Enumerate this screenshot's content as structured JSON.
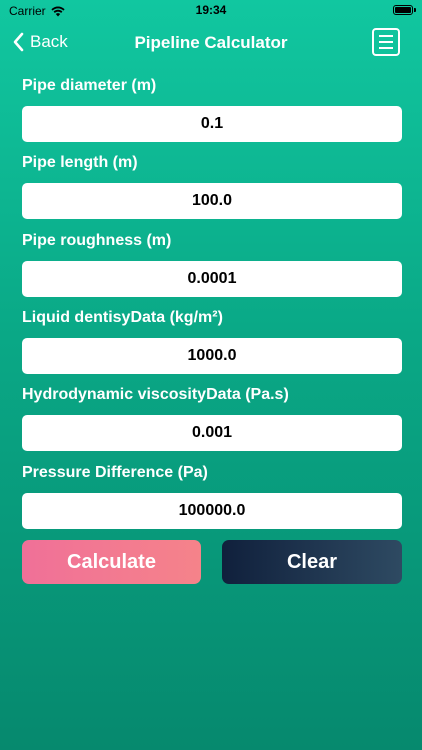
{
  "status_bar": {
    "carrier": "Carrier",
    "time": "19:34"
  },
  "nav": {
    "back_label": "Back",
    "title": "Pipeline Calculator"
  },
  "fields": [
    {
      "label": "Pipe diameter (m)",
      "value": "0.1"
    },
    {
      "label": "Pipe length (m)",
      "value": "100.0"
    },
    {
      "label": "Pipe roughness (m)",
      "value": "0.0001"
    },
    {
      "label": "Liquid dentisyData (kg/m²)",
      "value": "1000.0"
    },
    {
      "label": "Hydrodynamic viscosityData (Pa.s)",
      "value": "0.001"
    },
    {
      "label": "Pressure Difference (Pa)",
      "value": "100000.0"
    }
  ],
  "buttons": {
    "calculate": "Calculate",
    "clear": "Clear"
  },
  "colors": {
    "background_top": "#11c7a0",
    "background_bottom": "#06896e",
    "calculate_button": "#f07098",
    "clear_button": "#10203c"
  }
}
